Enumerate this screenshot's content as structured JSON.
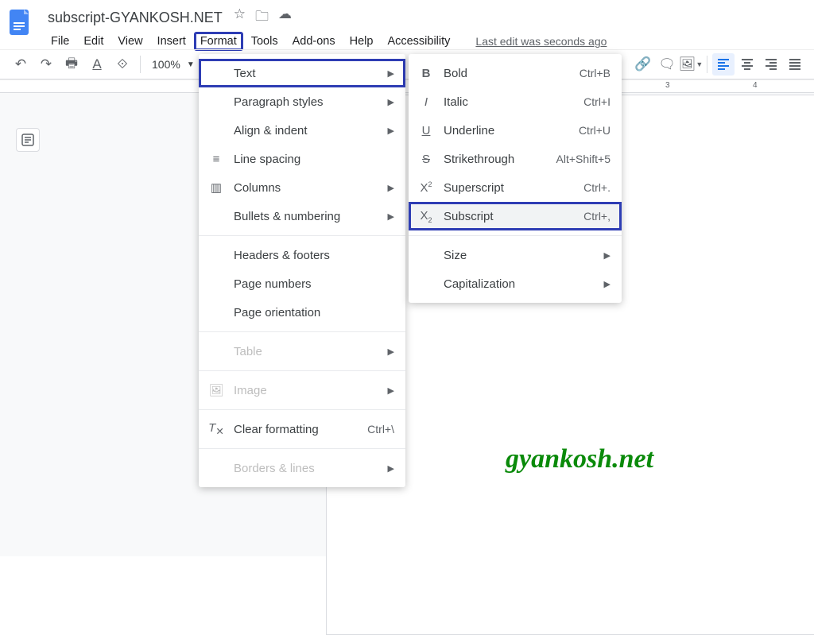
{
  "header": {
    "title": "subscript-GYANKOSH.NET",
    "last_edit": "Last edit was seconds ago"
  },
  "menubar": {
    "file": "File",
    "edit": "Edit",
    "view": "View",
    "insert": "Insert",
    "format": "Format",
    "tools": "Tools",
    "addons": "Add-ons",
    "help": "Help",
    "accessibility": "Accessibility"
  },
  "toolbar": {
    "zoom": "100%"
  },
  "ruler": {
    "n3": "3",
    "n4": "4"
  },
  "watermark": "gyankosh.net",
  "format_menu": {
    "text": "Text",
    "paragraph": "Paragraph styles",
    "align": "Align & indent",
    "line_spacing": "Line spacing",
    "columns": "Columns",
    "bullets": "Bullets & numbering",
    "headers": "Headers & footers",
    "page_numbers": "Page numbers",
    "page_orientation": "Page orientation",
    "table": "Table",
    "image": "Image",
    "clear_formatting": "Clear formatting",
    "clear_formatting_shortcut": "Ctrl+\\",
    "borders": "Borders & lines"
  },
  "text_menu": {
    "bold": "Bold",
    "bold_s": "Ctrl+B",
    "italic": "Italic",
    "italic_s": "Ctrl+I",
    "underline": "Underline",
    "underline_s": "Ctrl+U",
    "strike": "Strikethrough",
    "strike_s": "Alt+Shift+5",
    "super": "Superscript",
    "super_s": "Ctrl+.",
    "sub": "Subscript",
    "sub_s": "Ctrl+,",
    "size": "Size",
    "cap": "Capitalization"
  }
}
